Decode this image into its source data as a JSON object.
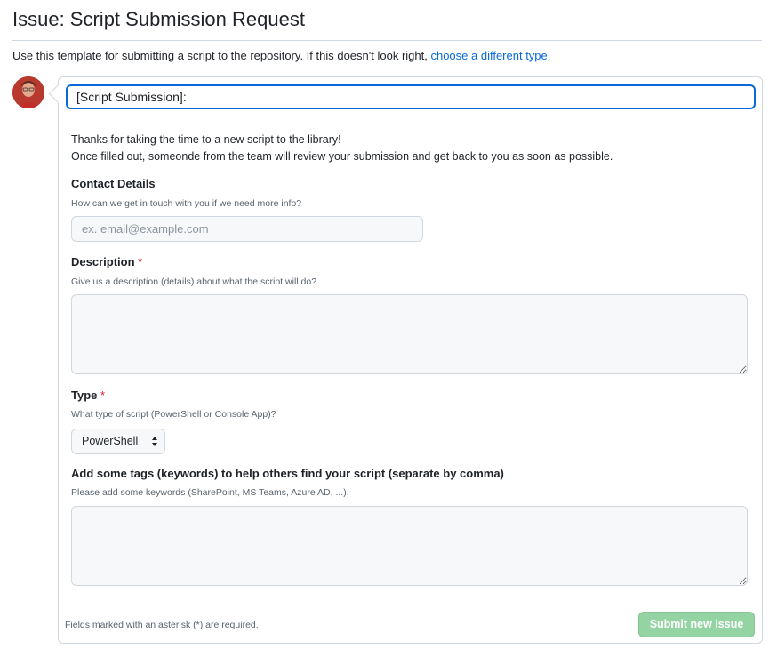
{
  "page": {
    "title": "Issue: Script Submission Request",
    "template_note": "Use this template for submitting a script to the repository. If this doesn't look right,",
    "template_link": "choose a different type."
  },
  "form": {
    "title_value": "[Script Submission]:",
    "intro_line1": "Thanks for taking the time to a new script to the library!",
    "intro_line2": "Once filled out, someonde from the team will review your submission and get back to you as soon as possible.",
    "contact": {
      "label": "Contact Details",
      "hint": "How can we get in touch with you if we need more info?",
      "placeholder": "ex. email@example.com"
    },
    "description": {
      "label": "Description",
      "required_mark": "*",
      "hint": "Give us a description (details) about what the script will do?"
    },
    "type": {
      "label": "Type",
      "required_mark": "*",
      "hint": "What type of script (PowerShell or Console App)?",
      "selected": "PowerShell"
    },
    "tags": {
      "label": "Add some tags (keywords) to help others find your script (separate by comma)",
      "hint": "Please add some keywords (SharePoint, MS Teams, Azure AD, ...)."
    },
    "footer_note": "Fields marked with an asterisk (*) are required.",
    "submit_label": "Submit new issue"
  },
  "colors": {
    "accent": "#0969da",
    "required": "#cf222e",
    "submit_disabled": "#94d3a2"
  }
}
